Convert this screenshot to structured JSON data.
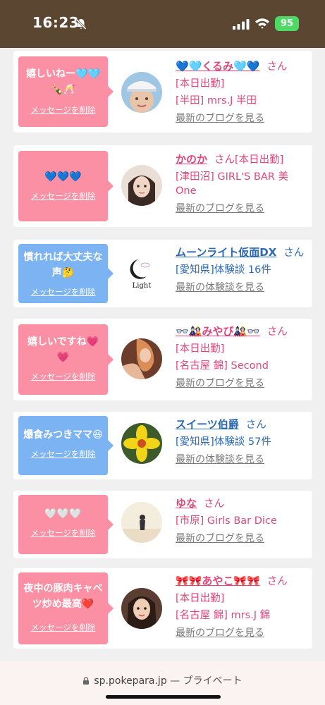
{
  "status_bar": {
    "time": "16:23",
    "battery": "95"
  },
  "cards": [
    {
      "bubble_color": "pink",
      "message_lines": [
        "嬉しいねー🩵🩵",
        "🍾🥂"
      ],
      "delete_label": "メッセージを削除",
      "avatar": "avatar-photo-kurumi",
      "name": "💙🩵くるみ🩵💙",
      "name_color": "pink",
      "san": "さん",
      "lines": [
        "[本日出勤]",
        "[半田] mrs.J 半田"
      ],
      "link": "最新のブログを見る"
    },
    {
      "bubble_color": "pink",
      "message_lines": [
        "💙💙💙"
      ],
      "delete_label": "メッセージを削除",
      "avatar": "avatar-photo-kanoka",
      "name": "かのか",
      "name_color": "pink",
      "san": "さん[本日出勤]",
      "lines": [
        "[津田沼] GIRL'S BAR 美",
        "One"
      ],
      "link": "最新のブログを見る"
    },
    {
      "bubble_color": "blue",
      "message_lines": [
        "慣れれば大丈夫な",
        "声🤔"
      ],
      "delete_label": "メッセージを削除",
      "avatar": "avatar-logo-moonlight",
      "logo_text": "Light",
      "name": "ムーンライト仮面DX",
      "name_color": "blue",
      "san": "さん",
      "lines": [
        "[愛知県]体験談 16件"
      ],
      "link": "最新の体験談を見る"
    },
    {
      "bubble_color": "pink",
      "message_lines": [
        "嬉しいですね💗",
        "💗"
      ],
      "delete_label": "メッセージを削除",
      "avatar": "avatar-photo-miyabi",
      "name": "👓🎎みやび🎎👓",
      "name_color": "pink",
      "san": "さん",
      "lines": [
        "[本日出勤]",
        "[名古屋 錦] Second"
      ],
      "link": "最新のブログを見る"
    },
    {
      "bubble_color": "blue",
      "message_lines": [
        "爆食みつきママ😆"
      ],
      "delete_label": "メッセージを削除",
      "avatar": "avatar-photo-flower",
      "name": "スイーツ伯爵",
      "name_color": "blue",
      "san": "さん",
      "lines": [
        "[愛知県]体験談 57件"
      ],
      "link": "最新の体験談を見る"
    },
    {
      "bubble_color": "pink",
      "message_lines": [
        "🤍🤍🤍"
      ],
      "delete_label": "メッセージを削除",
      "avatar": "avatar-photo-yuna",
      "name": "ゆな",
      "name_color": "pink",
      "san": "さん",
      "lines": [
        "[市原] Girls Bar Dice"
      ],
      "link": "最新のブログを見る"
    },
    {
      "bubble_color": "pink",
      "message_lines": [
        "夜中の豚肉キャベ",
        "ツ炒め最高❤️"
      ],
      "delete_label": "メッセージを削除",
      "avatar": "avatar-photo-ayako",
      "name": "🎀🎀あやこ🎀🎀",
      "name_color": "pink",
      "san": "さん",
      "lines": [
        "[本日出勤]",
        "[名古屋 錦] mrs.J 錦"
      ],
      "link": "最新のブログを見る"
    }
  ],
  "bottom_bar": {
    "url": "sp.pokepara.jp",
    "private": "— プライベート"
  }
}
